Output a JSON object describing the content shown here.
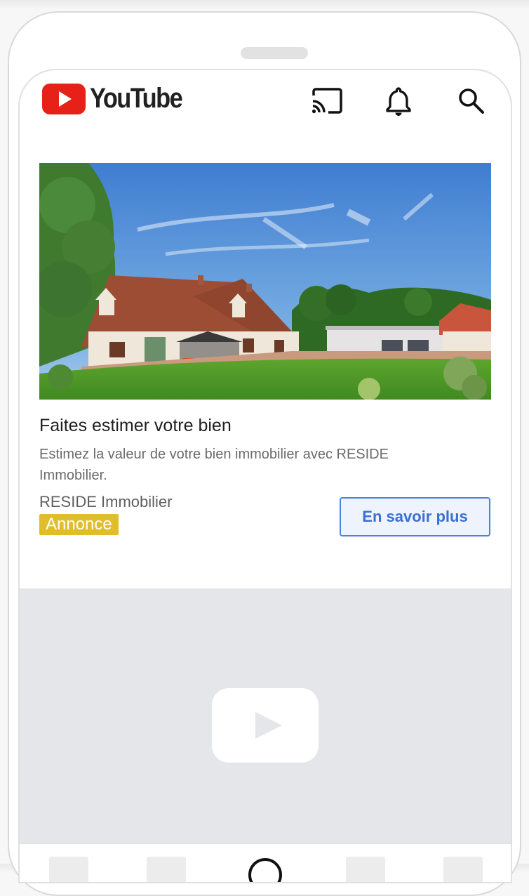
{
  "app": {
    "name": "YouTube"
  },
  "header": {
    "logo_text": "YouTube",
    "icons": [
      "cast-icon",
      "bell-icon",
      "search-icon"
    ]
  },
  "ad": {
    "title": "Faites estimer votre bien",
    "description": "Estimez la valeur de votre bien immobilier avec RESIDE Immobilier.",
    "advertiser": "RESIDE Immobilier",
    "badge": "Annonce",
    "cta_label": "En savoir plus"
  },
  "colors": {
    "brand_red": "#e62117",
    "badge_yellow": "#e1bd2b",
    "cta_blue": "#3a6fd3",
    "placeholder_gray": "#e5e6e9"
  },
  "bottom_nav": {
    "items": [
      "nav-item-1",
      "nav-item-2",
      "nav-item-center",
      "nav-item-4",
      "nav-item-5"
    ]
  }
}
